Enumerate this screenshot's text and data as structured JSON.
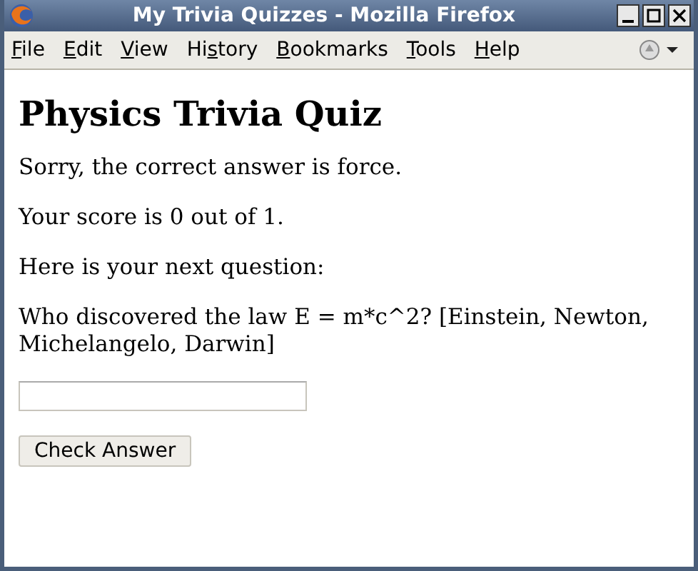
{
  "window": {
    "title": "My Trivia Quizzes - Mozilla Firefox"
  },
  "menu": [
    {
      "parts": [
        {
          "text": "F",
          "underlined": true
        },
        {
          "text": "ile",
          "underlined": false
        }
      ]
    },
    {
      "parts": [
        {
          "text": "E",
          "underlined": true
        },
        {
          "text": "dit",
          "underlined": false
        }
      ]
    },
    {
      "parts": [
        {
          "text": "V",
          "underlined": true
        },
        {
          "text": "iew",
          "underlined": false
        }
      ]
    },
    {
      "parts": [
        {
          "text": "Hi",
          "underlined": false
        },
        {
          "text": "s",
          "underlined": true
        },
        {
          "text": "tory",
          "underlined": false
        }
      ]
    },
    {
      "parts": [
        {
          "text": "B",
          "underlined": true
        },
        {
          "text": "ookmarks",
          "underlined": false
        }
      ]
    },
    {
      "parts": [
        {
          "text": "T",
          "underlined": true
        },
        {
          "text": "ools",
          "underlined": false
        }
      ]
    },
    {
      "parts": [
        {
          "text": "H",
          "underlined": true
        },
        {
          "text": "elp",
          "underlined": false
        }
      ]
    }
  ],
  "page": {
    "heading": "Physics Trivia Quiz",
    "paragraphs": [
      "Sorry, the correct answer is force.",
      "Your score is 0 out of 1.",
      "Here is your next question:",
      "Who discovered the law E = m*c^2? [Einstein, Newton, Michelangelo, Darwin]"
    ],
    "button": "Check Answer"
  }
}
